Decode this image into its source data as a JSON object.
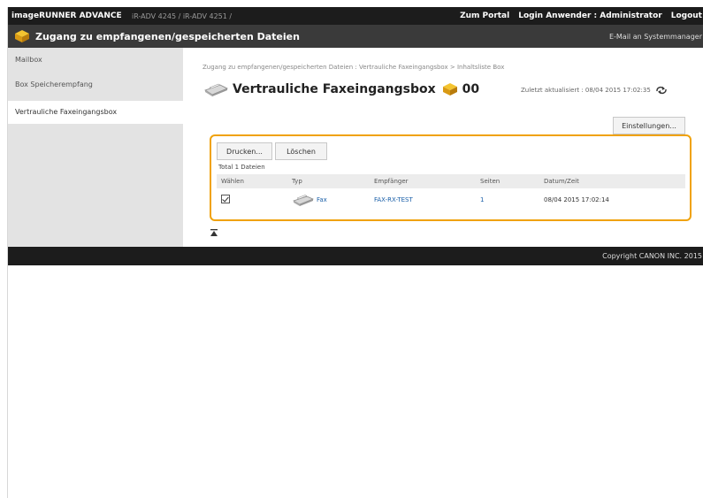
{
  "topbar": {
    "brand": "imageRUNNER ADVANCE",
    "host": "iR-ADV 4245 / iR-ADV 4251 /",
    "portal": "Zum Portal",
    "login_label": "Login Anwender :",
    "user": "Administrator",
    "logout": "Logout"
  },
  "titlebar": {
    "title": "Zugang zu empfangenen/gespeicherten Dateien",
    "mail_link": "E-Mail an Systemmanager"
  },
  "sidebar": {
    "items": [
      {
        "label": "Mailbox"
      },
      {
        "label": "Box Speicherempfang"
      },
      {
        "label": "Vertrauliche Faxeingangsbox"
      }
    ]
  },
  "main": {
    "breadcrumb": "Zugang zu empfangenen/gespeicherten Dateien : Vertrauliche Faxeingangsbox > Inhaltsliste Box",
    "title": "Vertrauliche Faxeingangsbox",
    "box_number": "00",
    "updated": "Zuletzt aktualisiert : 08/04 2015 17:02:35",
    "settings_button": "Einstellungen...",
    "print_button": "Drucken...",
    "delete_button": "Löschen",
    "total": "Total 1 Dateien",
    "columns": [
      "Wählen",
      "Typ",
      "Empfänger",
      "Seiten",
      "Datum/Zeit"
    ],
    "rows": [
      {
        "checked": true,
        "type": "Fax",
        "recipient": "FAX-RX-TEST",
        "pages": "1",
        "datetime": "08/04 2015 17:02:14"
      }
    ]
  },
  "footer": {
    "copyright": "Copyright CANON INC. 2015"
  },
  "colors": {
    "topbar": "#1c1c1c",
    "titlebar": "#3a3a3a",
    "highlight": "#f0a20a",
    "link": "#1a5fa8"
  }
}
